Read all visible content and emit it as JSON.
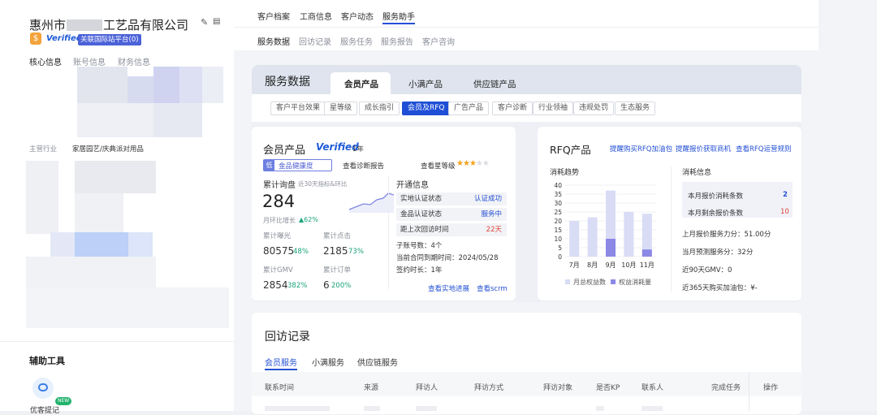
{
  "company": {
    "name": "惠州市",
    "name_suffix": "工艺品有限公司",
    "verified": "Verified",
    "platform_badge": "关联国际站平台(0)",
    "tabs": [
      "核心信息",
      "账号信息",
      "财务信息"
    ],
    "industry_label": "主营行业",
    "industry_value": "家居园艺/庆典派对用品"
  },
  "tools": {
    "title": "辅助工具",
    "new_badge": "NEW",
    "item_label": "优客提记"
  },
  "top_nav": [
    "客户档案",
    "工商信息",
    "客户动态",
    "服务助手"
  ],
  "sub_nav": [
    "服务数据",
    "回访记录",
    "服务任务",
    "服务报告",
    "客户咨询"
  ],
  "service": {
    "title": "服务数据",
    "tabs": [
      "会员产品",
      "小满产品",
      "供应链产品"
    ],
    "pills": [
      "客户平台效果",
      "星等级",
      "成长指引",
      "会员及RFQ",
      "广告产品",
      "客户诊断",
      "行业领袖",
      "违规处罚",
      "生态服务"
    ]
  },
  "member": {
    "title": "会员产品",
    "verified": "Verified",
    "years": "1年",
    "health_prefix": "低",
    "health_label": "金品健康度",
    "diag_link": "查看诊断报告",
    "star_label": "查看星等级",
    "stars": 3,
    "stars_total": 5,
    "inquiry_label": "累计询盘",
    "inquiry_hint": "近30天指标&环比",
    "inquiry_value": "284",
    "mom_label": "月环比增长",
    "mom_value": "62%",
    "metrics": [
      {
        "label": "累计曝光",
        "value": "80575",
        "pct": "48%"
      },
      {
        "label": "累计点击",
        "value": "2185",
        "pct": "73%"
      },
      {
        "label": "累计GMV",
        "value": "2854",
        "pct": "382%"
      },
      {
        "label": "累计订单",
        "value": "6",
        "pct": "200%"
      }
    ],
    "open_title": "开通信息",
    "open_rows": [
      {
        "label": "实地认证状态",
        "value": "认证成功"
      },
      {
        "label": "金品认证状态",
        "value": "服务中"
      },
      {
        "label": "距上次回访时间",
        "value": "22天"
      }
    ],
    "sub_accounts": "子账号数：4个",
    "contract_end": "当前合同到期时间：2024/05/28",
    "signed": "签约时长：1年",
    "links": [
      "查看实地进展",
      "查看scrm"
    ]
  },
  "rfq": {
    "title": "RFQ产品",
    "links": [
      "提醒购买RFQ加油包",
      "提醒报价获取商机",
      "查看RFQ运营规则"
    ],
    "trend_title": "消耗趋势",
    "info_title": "消耗信息",
    "info_rows": [
      {
        "label": "本月报价消耗条数",
        "value": "2"
      },
      {
        "label": "本月剩余报价条数",
        "value": "10"
      }
    ],
    "lines": [
      "上月报价服务力分：51.00分",
      "当月预测服务分：32分",
      "近90天GMV：0",
      "近365天购买加油包：¥-"
    ]
  },
  "visit": {
    "title": "回访记录",
    "tabs": [
      "会员服务",
      "小满服务",
      "供应链服务"
    ],
    "headers": [
      "联系时间",
      "来源",
      "拜访人",
      "拜访方式",
      "拜访对象",
      "是否KP",
      "联系人",
      "完成任务",
      "操作"
    ]
  },
  "chart_data": {
    "type": "bar",
    "categories": [
      "7月",
      "8月",
      "9月",
      "10月",
      "11月"
    ],
    "ylim": [
      0,
      40
    ],
    "yticks": [
      0,
      5,
      10,
      15,
      20,
      25,
      30,
      35,
      40
    ],
    "series": [
      {
        "name": "月总权益数",
        "values": [
          20,
          22,
          37,
          25,
          24
        ]
      },
      {
        "name": "权益消耗量",
        "values": [
          0,
          0,
          10,
          0,
          4
        ]
      }
    ],
    "colors": [
      "#d9dcf5",
      "#8b88e6"
    ],
    "legend": "bottom"
  }
}
